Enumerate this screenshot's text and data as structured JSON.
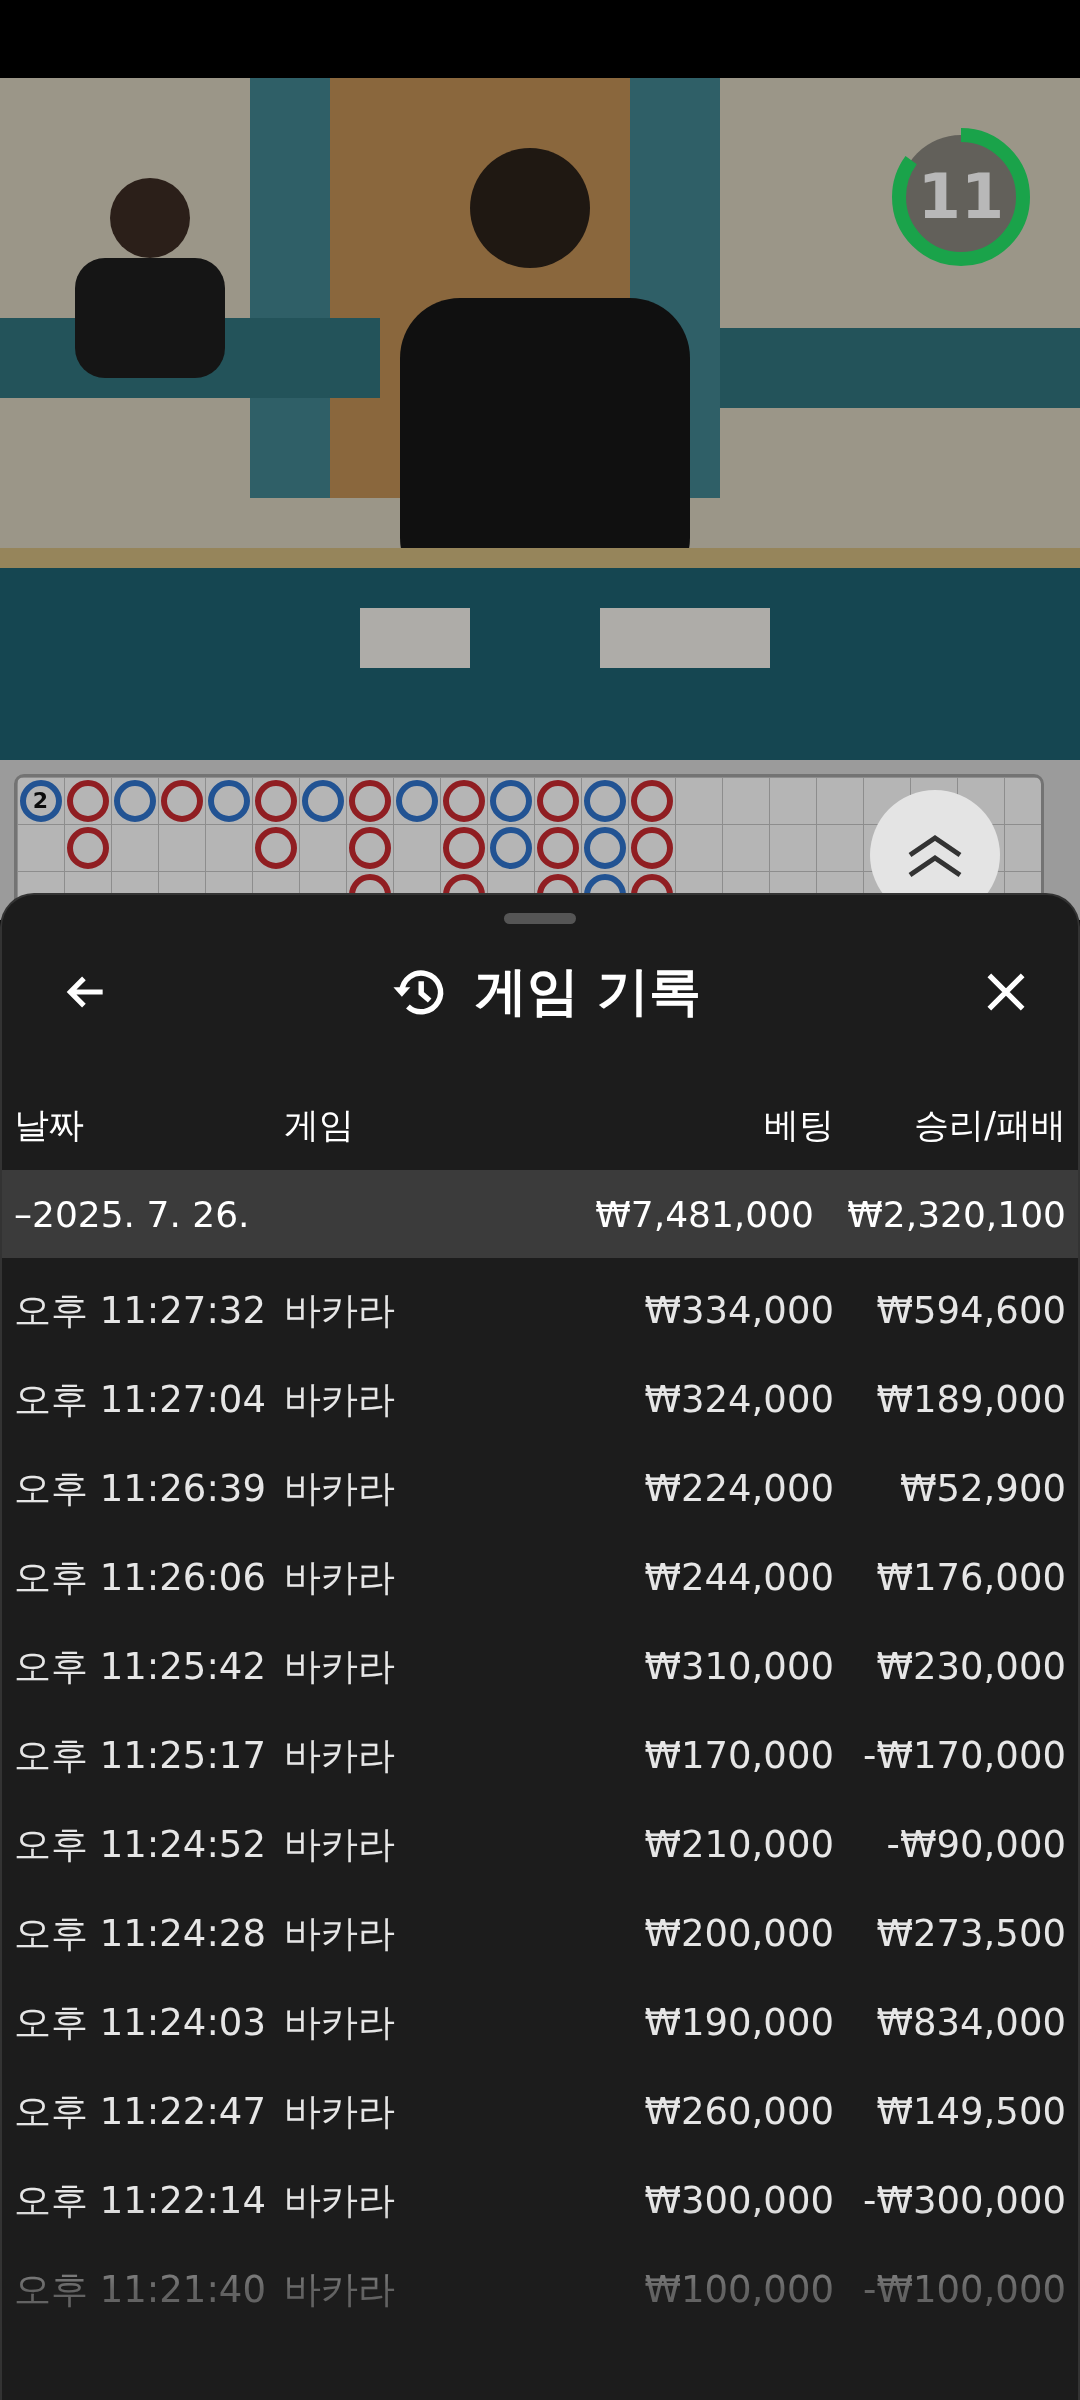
{
  "countdown": {
    "value": "11",
    "level": 0.85
  },
  "road": {
    "columns": [
      [
        {
          "kind": "player",
          "label": "2"
        }
      ],
      [
        {
          "kind": "banker"
        },
        {
          "kind": "banker"
        }
      ],
      [
        {
          "kind": "player"
        }
      ],
      [
        {
          "kind": "banker"
        }
      ],
      [
        {
          "kind": "player"
        }
      ],
      [
        {
          "kind": "banker"
        },
        {
          "kind": "banker"
        }
      ],
      [
        {
          "kind": "player"
        }
      ],
      [
        {
          "kind": "banker"
        },
        {
          "kind": "banker"
        },
        {
          "kind": "banker"
        }
      ],
      [
        {
          "kind": "player"
        }
      ],
      [
        {
          "kind": "banker"
        },
        {
          "kind": "banker"
        },
        {
          "kind": "banker"
        }
      ],
      [
        {
          "kind": "player"
        },
        {
          "kind": "player"
        }
      ],
      [
        {
          "kind": "banker"
        },
        {
          "kind": "banker"
        },
        {
          "kind": "banker"
        }
      ],
      [
        {
          "kind": "player"
        },
        {
          "kind": "player"
        },
        {
          "kind": "player"
        }
      ],
      [
        {
          "kind": "banker"
        },
        {
          "kind": "banker"
        },
        {
          "kind": "banker"
        }
      ]
    ]
  },
  "sheet": {
    "title": "게임 기록",
    "columns": [
      "날짜",
      "게임",
      "베팅",
      "승리/패배"
    ],
    "day": {
      "date": "–2025. 7. 26.",
      "bet": "₩7,481,000",
      "result": "₩2,320,100"
    },
    "rows": [
      {
        "time": "오후 11:27:32",
        "game": "바카라",
        "bet": "₩334,000",
        "result": "₩594,600"
      },
      {
        "time": "오후 11:27:04",
        "game": "바카라",
        "bet": "₩324,000",
        "result": "₩189,000"
      },
      {
        "time": "오후 11:26:39",
        "game": "바카라",
        "bet": "₩224,000",
        "result": "₩52,900"
      },
      {
        "time": "오후 11:26:06",
        "game": "바카라",
        "bet": "₩244,000",
        "result": "₩176,000"
      },
      {
        "time": "오후 11:25:42",
        "game": "바카라",
        "bet": "₩310,000",
        "result": "₩230,000"
      },
      {
        "time": "오후 11:25:17",
        "game": "바카라",
        "bet": "₩170,000",
        "result": "-₩170,000"
      },
      {
        "time": "오후 11:24:52",
        "game": "바카라",
        "bet": "₩210,000",
        "result": "-₩90,000"
      },
      {
        "time": "오후 11:24:28",
        "game": "바카라",
        "bet": "₩200,000",
        "result": "₩273,500"
      },
      {
        "time": "오후 11:24:03",
        "game": "바카라",
        "bet": "₩190,000",
        "result": "₩834,000"
      },
      {
        "time": "오후 11:22:47",
        "game": "바카라",
        "bet": "₩260,000",
        "result": "₩149,500"
      },
      {
        "time": "오후 11:22:14",
        "game": "바카라",
        "bet": "₩300,000",
        "result": "-₩300,000"
      },
      {
        "time": "오후 11:21:40",
        "game": "바카라",
        "bet": "₩100,000",
        "result": "-₩100,000"
      }
    ]
  }
}
